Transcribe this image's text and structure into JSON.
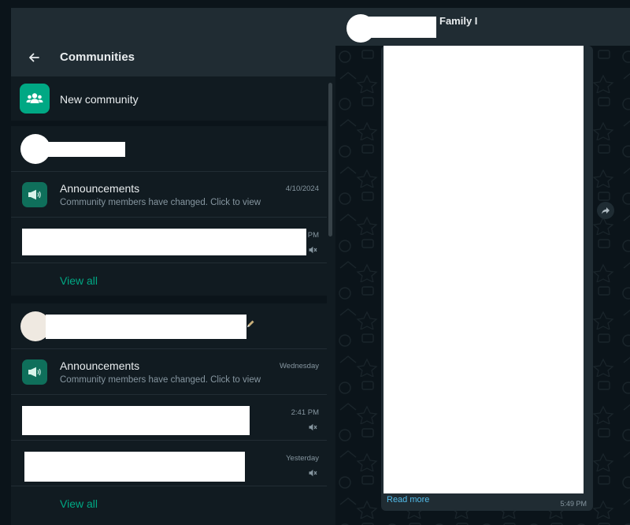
{
  "header": {
    "title": "Communities"
  },
  "new_community": {
    "label": "New community"
  },
  "communities": [
    {
      "announcement": {
        "title": "Announcements",
        "subtitle": "Community members have changed. Click to view",
        "time": "4/10/2024"
      },
      "groups": [
        {
          "time": "PM"
        }
      ],
      "view_all": "View all"
    },
    {
      "announcement": {
        "title": "Announcements",
        "subtitle": "Community members have changed. Click to view",
        "time": "Wednesday"
      },
      "groups": [
        {
          "time": "2:41 PM"
        },
        {
          "time": "Yesterday"
        }
      ],
      "view_all": "View all"
    }
  ],
  "chat": {
    "title": "Family I",
    "message": {
      "read_more": "Read more",
      "time": "5:49 PM"
    }
  },
  "colors": {
    "accent": "#00a884",
    "panel": "#111b21",
    "header": "#202c33",
    "link": "#53bdeb"
  }
}
